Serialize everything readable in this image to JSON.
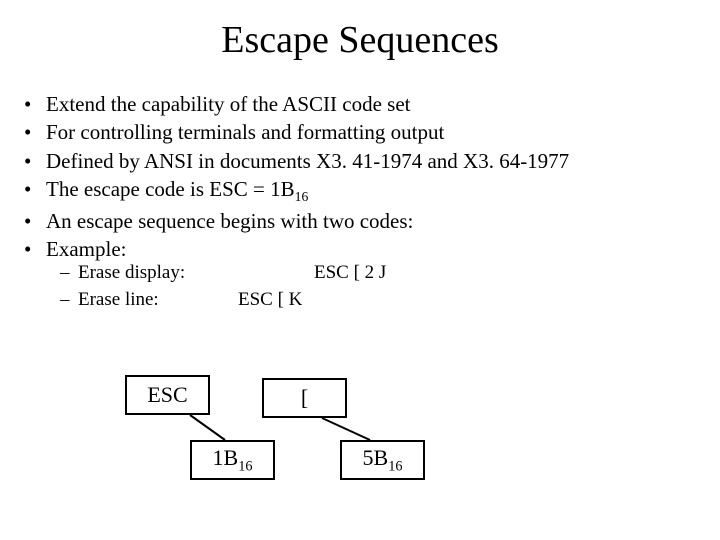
{
  "title": "Escape Sequences",
  "bullets": [
    "Extend the capability of the ASCII code set",
    "For controlling terminals and formatting output",
    "Defined by ANSI in documents X3. 41-1974 and X3. 64-1977",
    "The escape code is ESC =  1B",
    "An escape sequence begins with two codes:",
    "Example:"
  ],
  "bullet3_sub": "16",
  "sub": [
    {
      "label": "Erase display:",
      "code": "                ESC [ 2 J"
    },
    {
      "label": "Erase line:",
      "code": "ESC [ K"
    }
  ],
  "boxes": {
    "esc": "ESC",
    "lbr": "[",
    "b1": {
      "main": "1B",
      "sub": "16"
    },
    "b2": {
      "main": "5B",
      "sub": "16"
    }
  }
}
